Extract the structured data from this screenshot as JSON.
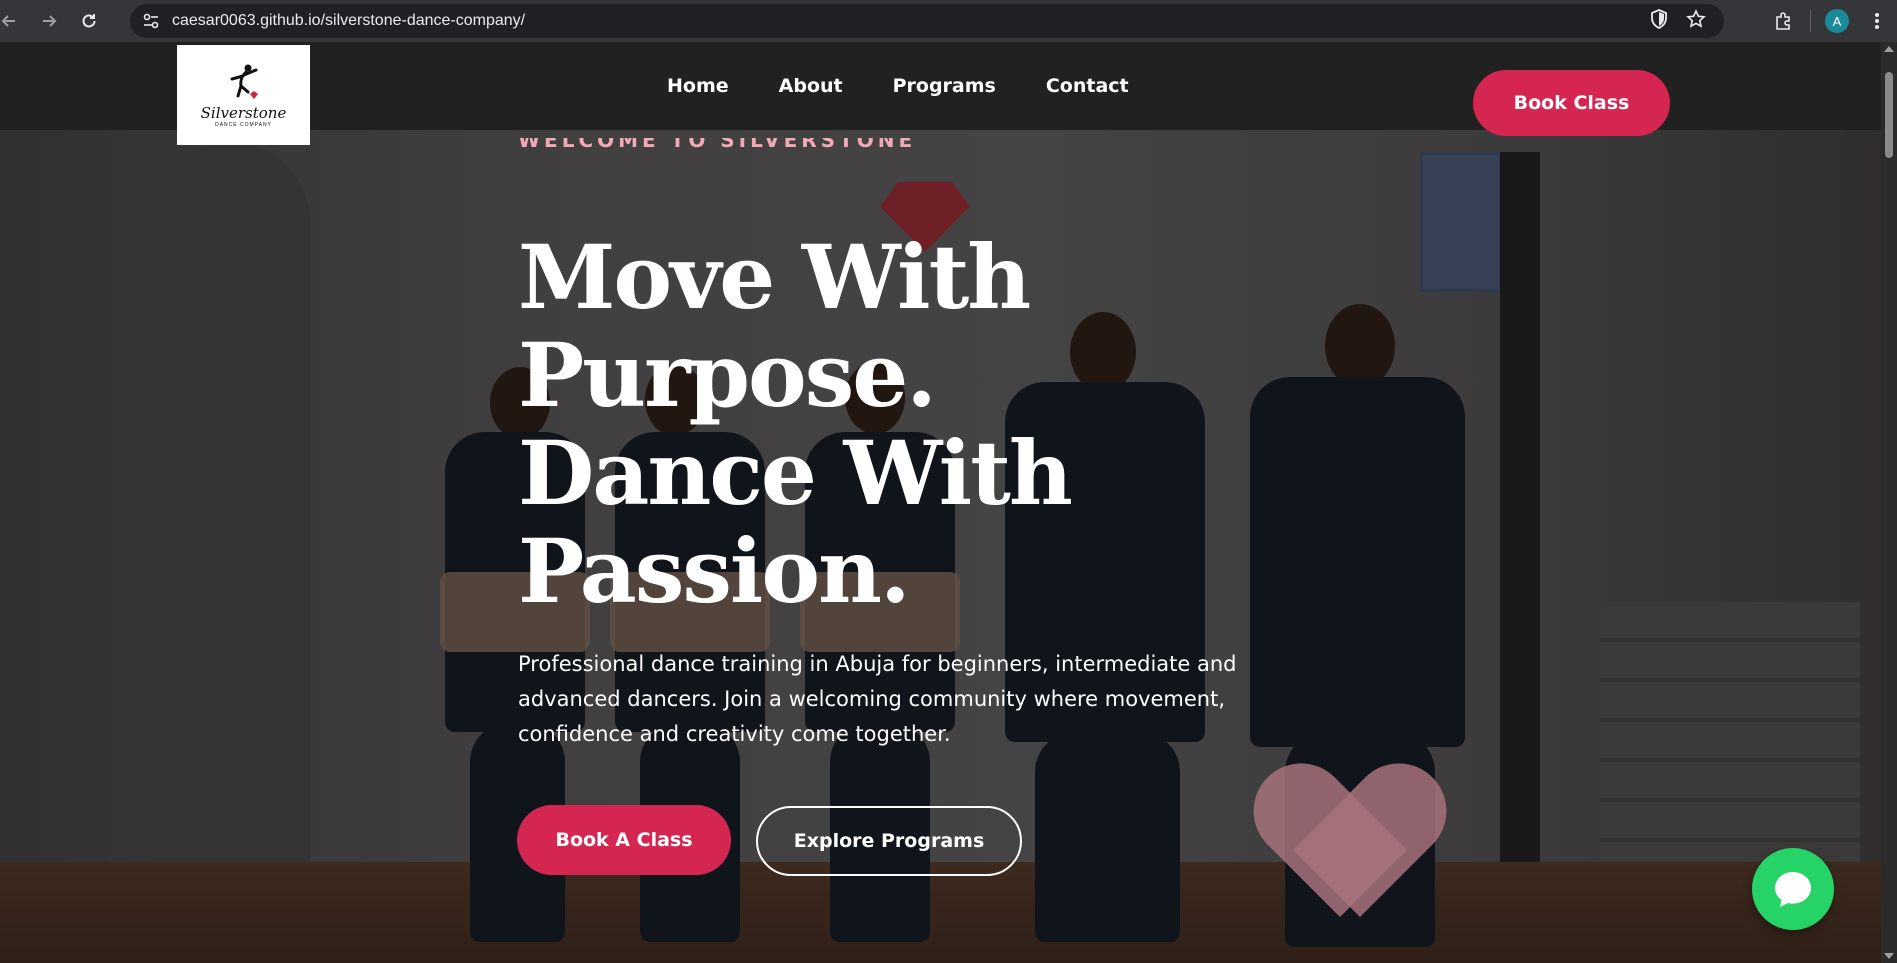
{
  "browser": {
    "url_host": "caesar0063.github.io",
    "url_path": "/silverstone-dance-company/",
    "profile_initial": "A",
    "icons": [
      "back-icon",
      "forward-icon",
      "reload-icon",
      "site-info-icon",
      "shield-icon",
      "star-icon",
      "extensions-icon",
      "menu-icon"
    ]
  },
  "site": {
    "logo": {
      "name": "Silverstone",
      "sub": "DANCE COMPANY"
    },
    "nav": [
      {
        "label": "Home"
      },
      {
        "label": "About"
      },
      {
        "label": "Programs"
      },
      {
        "label": "Contact"
      }
    ],
    "header_cta": "Book Class"
  },
  "hero": {
    "eyebrow": "WELCOME TO SILVERSTONE",
    "headline_lines": [
      "Move With",
      "Purpose.",
      "Dance With",
      "Passion."
    ],
    "subtext": "Professional dance training in Abuja for beginners, intermediate and advanced dancers. Join a welcoming community where movement, confidence and creativity come together.",
    "primary_cta": "Book A Class",
    "secondary_cta": "Explore Programs"
  },
  "colors": {
    "accent": "#d42650",
    "header_bg": "#212121",
    "chat_green": "#25d366",
    "eyebrow": "#f1a9b8"
  }
}
